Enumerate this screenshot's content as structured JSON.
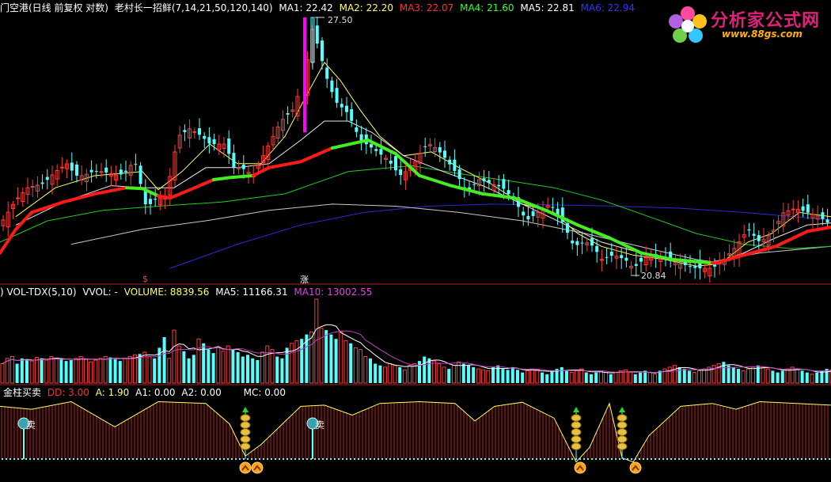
{
  "main_header": {
    "stock": "门空港(日线 前复权 对数)",
    "indicator": "老村长一招鲜(7,14,21,50,120,140)",
    "ma1": "MA1: 22.42",
    "ma2": "MA2: 22.20",
    "ma3": "MA3: 22.07",
    "ma4": "MA4: 21.60",
    "ma5": "MA5: 22.81",
    "ma6": "MA6: 22.94"
  },
  "price_labels": {
    "high": "27.50",
    "low": "20.84",
    "sig1": "$",
    "sig2": "涨"
  },
  "vol_header": {
    "name": ") VOL-TDX(5,10)",
    "vvol": "VVOL: -",
    "volume": "VOLUME: 8839.56",
    "ma5": "MA5: 11166.31",
    "ma10": "MA10: 13002.55"
  },
  "ind_header": {
    "name": "金柱买卖",
    "dd": "DD: 3.00",
    "a": "A: 1.90",
    "a1": "A1: 0.00",
    "a2": "A2: 0.00",
    "mc": "MC: 0.00"
  },
  "sell_label": "卖",
  "logo": {
    "title": "分析家公式网",
    "url": "www.88gs.com"
  },
  "colors": {
    "up": "#ff3c3c",
    "down": "#54ffff",
    "ma_white": "#e8e8e8",
    "ma_yellow": "#ffff66",
    "ma_green": "#22cc22",
    "ma_gray": "#c8c8c8",
    "ma_blue": "#2a2ad8",
    "trend_up": "#ff1a1a",
    "trend_down": "#44ee22",
    "spike": "#ff00ff",
    "vol_ma10": "#c040c0"
  },
  "chart_data": {
    "type": "candlestick",
    "y_range": [
      20.84,
      27.5
    ],
    "high_point": 27.5,
    "low_point": 20.84,
    "close_path_anchors": [
      [
        0,
        22.0
      ],
      [
        20,
        22.6
      ],
      [
        35,
        22.9
      ],
      [
        55,
        23.0
      ],
      [
        70,
        23.3
      ],
      [
        85,
        23.5
      ],
      [
        95,
        23.2
      ],
      [
        105,
        23.2
      ],
      [
        118,
        23.3
      ],
      [
        130,
        23.3
      ],
      [
        150,
        23.2
      ],
      [
        160,
        23.3
      ],
      [
        170,
        23.6
      ],
      [
        185,
        22.4
      ],
      [
        195,
        22.6
      ],
      [
        210,
        22.7
      ],
      [
        225,
        24.2
      ],
      [
        240,
        24.4
      ],
      [
        255,
        24.2
      ],
      [
        265,
        24.0
      ],
      [
        285,
        24.0
      ],
      [
        295,
        23.4
      ],
      [
        305,
        23.4
      ],
      [
        320,
        23.2
      ],
      [
        340,
        24.0
      ],
      [
        355,
        24.6
      ],
      [
        370,
        24.9
      ],
      [
        385,
        25.8
      ],
      [
        395,
        27.2
      ],
      [
        405,
        26.4
      ],
      [
        415,
        25.6
      ],
      [
        425,
        25.1
      ],
      [
        440,
        24.8
      ],
      [
        455,
        24.1
      ],
      [
        470,
        23.9
      ],
      [
        490,
        23.6
      ],
      [
        505,
        23.2
      ],
      [
        520,
        23.4
      ],
      [
        535,
        23.9
      ],
      [
        545,
        24.0
      ],
      [
        560,
        23.7
      ],
      [
        575,
        23.3
      ],
      [
        590,
        22.8
      ],
      [
        605,
        23.1
      ],
      [
        620,
        23.0
      ],
      [
        635,
        22.9
      ],
      [
        650,
        22.6
      ],
      [
        665,
        22.1
      ],
      [
        680,
        22.3
      ],
      [
        695,
        22.5
      ],
      [
        710,
        22.1
      ],
      [
        725,
        21.5
      ],
      [
        740,
        21.6
      ],
      [
        750,
        21.5
      ],
      [
        760,
        21.2
      ],
      [
        775,
        21.3
      ],
      [
        790,
        21.2
      ],
      [
        800,
        21.0
      ],
      [
        820,
        21.3
      ],
      [
        840,
        21.2
      ],
      [
        860,
        21.1
      ],
      [
        880,
        21.0
      ],
      [
        900,
        21.0
      ],
      [
        915,
        21.2
      ],
      [
        930,
        21.5
      ],
      [
        945,
        21.9
      ],
      [
        960,
        21.6
      ],
      [
        975,
        21.8
      ],
      [
        990,
        22.3
      ],
      [
        1005,
        22.4
      ],
      [
        1020,
        22.3
      ],
      [
        1035,
        22.2
      ],
      [
        1050,
        22.0
      ]
    ],
    "trend_line": {
      "up_color": "#ff1a1a",
      "down_color": "#44ee22",
      "points": [
        [
          0,
          21.35,
          "u"
        ],
        [
          20,
          21.9,
          "u"
        ],
        [
          40,
          22.3,
          "u"
        ],
        [
          80,
          22.55,
          "u"
        ],
        [
          120,
          22.75,
          "u"
        ],
        [
          160,
          22.9,
          "u"
        ],
        [
          180,
          22.88,
          "d"
        ],
        [
          200,
          22.7,
          "d"
        ],
        [
          215,
          22.65,
          "u"
        ],
        [
          240,
          22.85,
          "u"
        ],
        [
          270,
          23.1,
          "u"
        ],
        [
          290,
          23.15,
          "d"
        ],
        [
          320,
          23.2,
          "d"
        ],
        [
          340,
          23.4,
          "u"
        ],
        [
          380,
          23.55,
          "u"
        ],
        [
          420,
          23.9,
          "u"
        ],
        [
          465,
          24.1,
          "d"
        ],
        [
          500,
          23.75,
          "d"
        ],
        [
          530,
          23.2,
          "d"
        ],
        [
          570,
          22.95,
          "d"
        ],
        [
          610,
          22.75,
          "d"
        ],
        [
          650,
          22.65,
          "d"
        ],
        [
          690,
          22.35,
          "d"
        ],
        [
          730,
          22.0,
          "d"
        ],
        [
          770,
          21.7,
          "d"
        ],
        [
          810,
          21.35,
          "d"
        ],
        [
          850,
          21.2,
          "d"
        ],
        [
          900,
          21.12,
          "d"
        ],
        [
          905,
          21.12,
          "u"
        ],
        [
          940,
          21.3,
          "u"
        ],
        [
          980,
          21.5,
          "u"
        ],
        [
          1020,
          21.85,
          "u"
        ],
        [
          1050,
          21.95,
          "u"
        ]
      ]
    },
    "ma_lines": [
      {
        "color": "#2a2ad8",
        "points": [
          [
            215,
            21.0
          ],
          [
            300,
            21.55
          ],
          [
            380,
            22.0
          ],
          [
            460,
            22.3
          ],
          [
            540,
            22.45
          ],
          [
            620,
            22.5
          ],
          [
            700,
            22.48
          ],
          [
            780,
            22.45
          ],
          [
            860,
            22.4
          ],
          [
            940,
            22.3
          ],
          [
            1050,
            22.12
          ]
        ]
      },
      {
        "color": "#c8c8c8",
        "points": [
          [
            90,
            21.55
          ],
          [
            180,
            21.9
          ],
          [
            260,
            22.1
          ],
          [
            340,
            22.35
          ],
          [
            420,
            22.5
          ],
          [
            500,
            22.45
          ],
          [
            580,
            22.3
          ],
          [
            660,
            22.1
          ],
          [
            740,
            21.8
          ],
          [
            820,
            21.45
          ],
          [
            880,
            21.2
          ],
          [
            900,
            21.15
          ],
          [
            960,
            21.35
          ],
          [
            1050,
            21.5
          ]
        ]
      },
      {
        "color": "#22cc22",
        "points": [
          [
            0,
            21.6
          ],
          [
            60,
            22.1
          ],
          [
            130,
            22.35
          ],
          [
            200,
            22.45
          ],
          [
            280,
            22.55
          ],
          [
            360,
            22.75
          ],
          [
            440,
            23.3
          ],
          [
            520,
            23.45
          ],
          [
            580,
            23.25
          ],
          [
            650,
            23.05
          ],
          [
            700,
            22.9
          ],
          [
            760,
            22.6
          ],
          [
            820,
            22.2
          ],
          [
            880,
            21.8
          ],
          [
            940,
            21.55
          ],
          [
            1000,
            21.45
          ],
          [
            1050,
            21.5
          ]
        ]
      },
      {
        "color": "#e8e8e8",
        "points": [
          [
            20,
            22.0
          ],
          [
            80,
            22.55
          ],
          [
            140,
            22.95
          ],
          [
            185,
            22.9
          ],
          [
            220,
            22.9
          ],
          [
            260,
            23.4
          ],
          [
            300,
            23.4
          ],
          [
            340,
            23.5
          ],
          [
            380,
            24.1
          ],
          [
            410,
            24.6
          ],
          [
            440,
            24.6
          ],
          [
            470,
            24.3
          ],
          [
            510,
            23.7
          ],
          [
            560,
            23.3
          ],
          [
            610,
            22.95
          ],
          [
            660,
            22.5
          ],
          [
            710,
            22.05
          ],
          [
            760,
            21.6
          ],
          [
            810,
            21.35
          ],
          [
            860,
            21.15
          ],
          [
            900,
            21.1
          ],
          [
            940,
            21.35
          ],
          [
            980,
            21.7
          ],
          [
            1020,
            22.0
          ],
          [
            1050,
            22.05
          ]
        ]
      },
      {
        "color": "#ffff66",
        "points": [
          [
            20,
            22.2
          ],
          [
            70,
            22.9
          ],
          [
            120,
            23.2
          ],
          [
            180,
            23.3
          ],
          [
            200,
            22.85
          ],
          [
            230,
            23.3
          ],
          [
            265,
            24.0
          ],
          [
            300,
            23.5
          ],
          [
            330,
            23.5
          ],
          [
            360,
            24.2
          ],
          [
            385,
            25.2
          ],
          [
            410,
            26.2
          ],
          [
            430,
            25.7
          ],
          [
            455,
            24.9
          ],
          [
            480,
            24.2
          ],
          [
            510,
            23.7
          ],
          [
            545,
            23.8
          ],
          [
            580,
            23.4
          ],
          [
            620,
            23.0
          ],
          [
            660,
            22.5
          ],
          [
            700,
            22.3
          ],
          [
            730,
            21.8
          ],
          [
            760,
            21.5
          ],
          [
            800,
            21.3
          ],
          [
            840,
            21.2
          ],
          [
            880,
            21.05
          ],
          [
            910,
            21.1
          ],
          [
            945,
            21.6
          ],
          [
            975,
            21.8
          ],
          [
            1010,
            22.3
          ],
          [
            1050,
            22.2
          ]
        ]
      }
    ],
    "spike": {
      "x": 385,
      "open": 24.3,
      "close": 27.5
    },
    "volume": {
      "bars": [
        22,
        28,
        30,
        22,
        28,
        26,
        25,
        29,
        28,
        26,
        30,
        28,
        27,
        25,
        26,
        28,
        30,
        27,
        24,
        26,
        28,
        30,
        29,
        27,
        25,
        28,
        30,
        32,
        33,
        35,
        30,
        28,
        40,
        52,
        28,
        60,
        42,
        36,
        28,
        32,
        50,
        45,
        38,
        34,
        40,
        36,
        42,
        38,
        35,
        30,
        32,
        28,
        26,
        35,
        42,
        38,
        30,
        28,
        40,
        45,
        48,
        50,
        55,
        58,
        95,
        62,
        60,
        55,
        50,
        58,
        48,
        45,
        40,
        38,
        30,
        28,
        22,
        20,
        18,
        22,
        20,
        18,
        15,
        20,
        22,
        25,
        30,
        28,
        25,
        22,
        18,
        16,
        20,
        24,
        22,
        20,
        18,
        16,
        15,
        14,
        18,
        20,
        16,
        15,
        18,
        15,
        12,
        14,
        16,
        15,
        12,
        10,
        14,
        16,
        18,
        14,
        12,
        14,
        16,
        12,
        10,
        12,
        14,
        12,
        10,
        12,
        14,
        15,
        12,
        10,
        12,
        14,
        12,
        10,
        14,
        16,
        18,
        20,
        18,
        16,
        14,
        12,
        14,
        16,
        18,
        20,
        22,
        24,
        20,
        18,
        16,
        14,
        16,
        18,
        20,
        18,
        16,
        14,
        12,
        14,
        16,
        18,
        16,
        14,
        12,
        10,
        12,
        14,
        16,
        15
      ],
      "max": 95
    },
    "jinzhu": {
      "wave_points": [
        [
          0,
          0.9
        ],
        [
          40,
          0.85
        ],
        [
          90,
          0.98
        ],
        [
          145,
          0.55
        ],
        [
          200,
          0.98
        ],
        [
          260,
          0.95
        ],
        [
          290,
          0.6
        ],
        [
          310,
          0.05
        ],
        [
          330,
          0.25
        ],
        [
          380,
          0.9
        ],
        [
          410,
          0.92
        ],
        [
          445,
          0.75
        ],
        [
          480,
          0.95
        ],
        [
          530,
          0.98
        ],
        [
          575,
          0.95
        ],
        [
          600,
          0.65
        ],
        [
          625,
          0.9
        ],
        [
          660,
          0.97
        ],
        [
          700,
          0.7
        ],
        [
          728,
          -0.05
        ],
        [
          745,
          0.2
        ],
        [
          770,
          0.95
        ],
        [
          786,
          0.02
        ],
        [
          800,
          -0.05
        ],
        [
          820,
          0.4
        ],
        [
          860,
          0.9
        ],
        [
          900,
          0.95
        ],
        [
          930,
          0.85
        ],
        [
          960,
          0.98
        ],
        [
          1050,
          0.92
        ]
      ],
      "buy_marks": [
        310,
        728,
        786
      ],
      "arrow_marks": [
        310,
        325,
        733,
        803
      ],
      "sell_marks": [
        30,
        395
      ]
    }
  }
}
